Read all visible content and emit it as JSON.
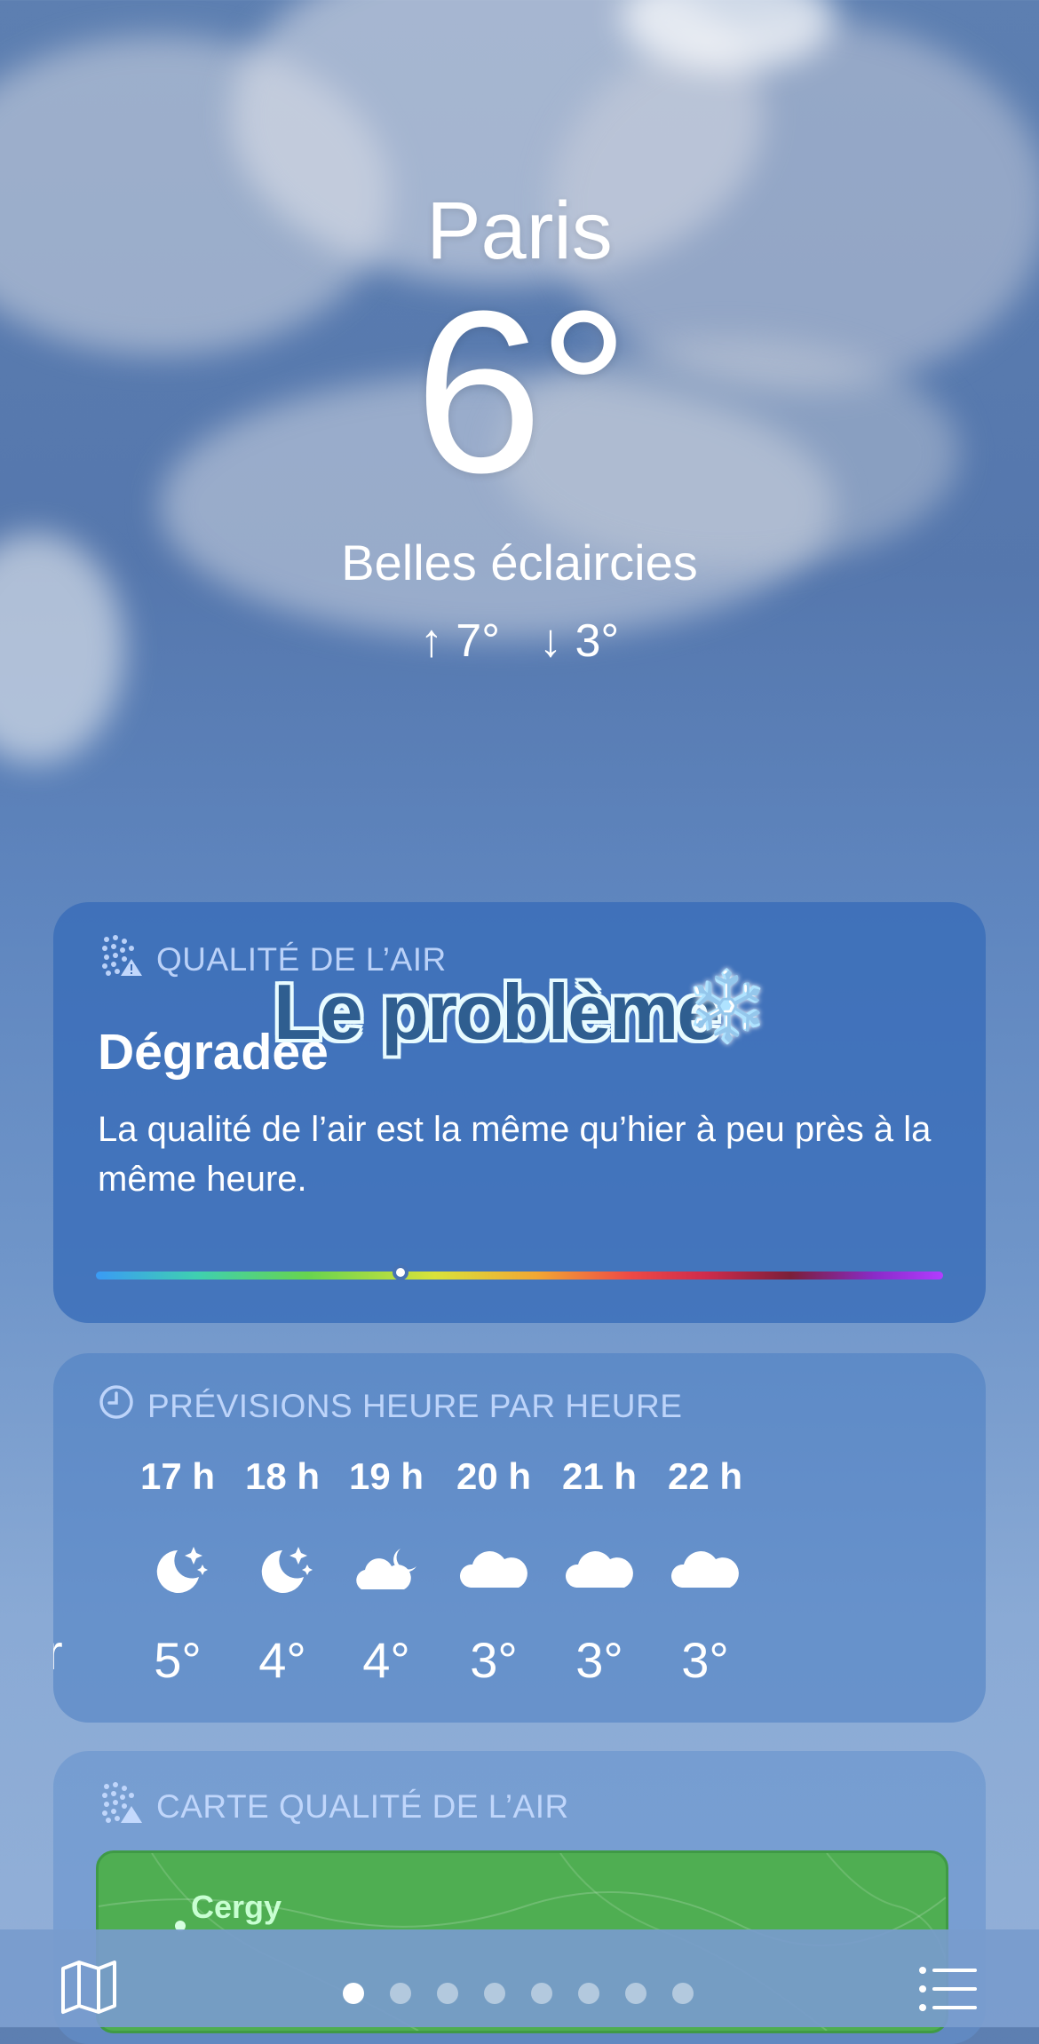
{
  "location": {
    "city": "Paris",
    "temperature": "6°",
    "condition": "Belles éclaircies",
    "high": "↑ 7°",
    "low": "↓ 3°"
  },
  "air_quality": {
    "title": "QUALITÉ DE L’AIR",
    "value": "Dégradée",
    "description": "La qualité de l’air est la même qu’hier à peu près à la même heure.",
    "scale_position": 0.36
  },
  "overlay": {
    "text": "Le problème",
    "emoji": "❄️"
  },
  "hourly": {
    "title": "PRÉVISIONS HEURE PAR HEURE",
    "leading_fragment": "r",
    "hours": [
      {
        "time": "17 h",
        "icon": "moon-stars-icon",
        "temp": "5°"
      },
      {
        "time": "18 h",
        "icon": "moon-stars-icon",
        "temp": "4°"
      },
      {
        "time": "19 h",
        "icon": "cloud-moon-icon",
        "temp": "4°"
      },
      {
        "time": "20 h",
        "icon": "cloud-icon",
        "temp": "3°"
      },
      {
        "time": "21 h",
        "icon": "cloud-icon",
        "temp": "3°"
      },
      {
        "time": "22 h",
        "icon": "cloud-icon",
        "temp": "3°"
      }
    ]
  },
  "air_map": {
    "title": "CARTE QUALITÉ DE L’AIR",
    "label": "Cergy"
  },
  "bottom_bar": {
    "page_count": 8,
    "active_page": 0
  }
}
